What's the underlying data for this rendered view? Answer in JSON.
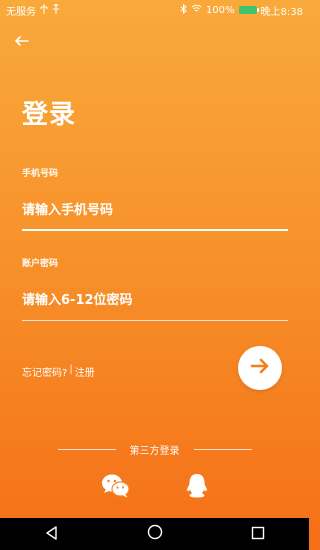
{
  "status_bar": {
    "carrier": "无服务",
    "battery": "100%",
    "time": "晚上8:38"
  },
  "icons": {
    "back": "arrow-left-icon",
    "submit": "arrow-right-icon",
    "wechat": "wechat-icon",
    "qq": "qq-icon"
  },
  "login": {
    "title": "登录",
    "phone_label": "手机号码",
    "phone_placeholder": "请输入手机号码",
    "password_label": "账户密码",
    "password_placeholder": "请输入6-12位密码",
    "forgot_password": "忘记密码?",
    "separator": "|",
    "register": "注册"
  },
  "third_party": {
    "title": "第三方登录"
  },
  "colors": {
    "gradient_top": "#f9a93a",
    "gradient_bottom": "#f56f17",
    "accent": "#f57f1f"
  }
}
